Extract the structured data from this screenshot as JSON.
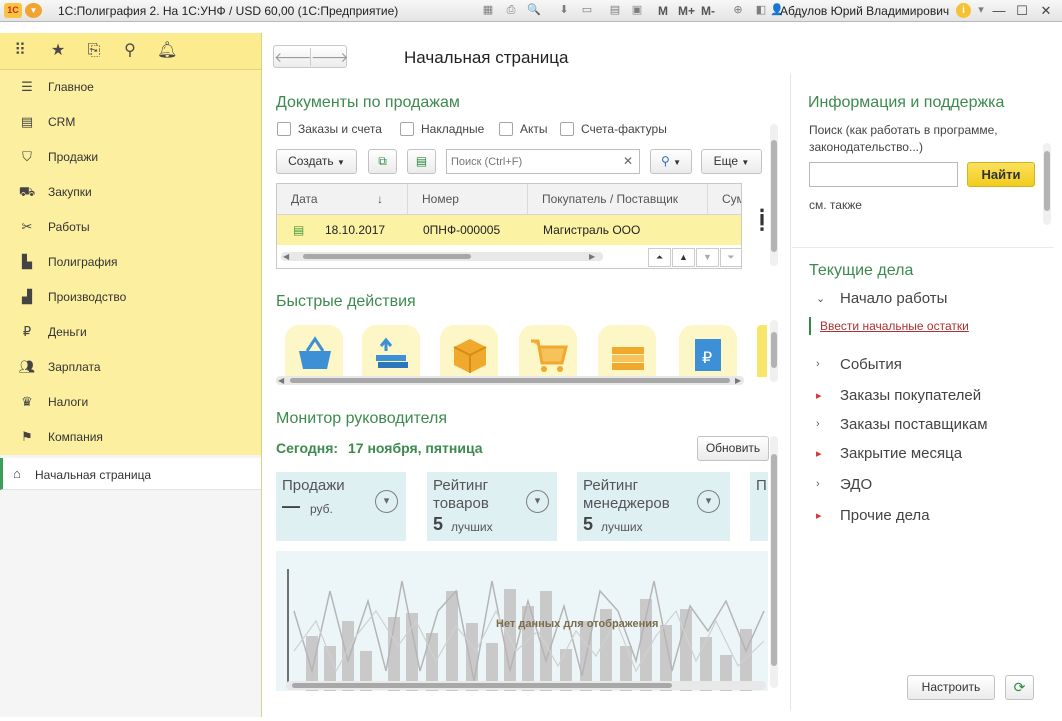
{
  "window": {
    "title": "1С:Полиграфия 2. На 1С:УНФ / USD 60,00 (1С:Предприятие)",
    "logo": "1С",
    "toolbar_text": [
      "M",
      "M+",
      "M-"
    ],
    "user": "Абдулов Юрий Владимирович"
  },
  "sidebar": {
    "top_icons": [
      "apps-grid-icon",
      "star-icon",
      "history-icon",
      "search-icon",
      "bell-icon"
    ],
    "sections": [
      {
        "label": "Главное",
        "icon": "list-icon"
      },
      {
        "label": "CRM",
        "icon": "crm-card-icon"
      },
      {
        "label": "Продажи",
        "icon": "basket-icon"
      },
      {
        "label": "Закупки",
        "icon": "cart-icon"
      },
      {
        "label": "Работы",
        "icon": "tools-icon"
      },
      {
        "label": "Полиграфия",
        "icon": "printing-icon"
      },
      {
        "label": "Производство",
        "icon": "factory-icon"
      },
      {
        "label": "Деньги",
        "icon": "ruble-icon"
      },
      {
        "label": "Зарплата",
        "icon": "people-icon"
      },
      {
        "label": "Налоги",
        "icon": "eagle-icon"
      },
      {
        "label": "Компания",
        "icon": "flag-icon"
      }
    ],
    "open_page": "Начальная страница"
  },
  "page": {
    "title": "Начальная страница"
  },
  "sales_docs": {
    "heading": "Документы по продажам",
    "filters": [
      "Заказы и счета",
      "Накладные",
      "Акты",
      "Счета-фактуры"
    ],
    "create_label": "Создать",
    "search_placeholder": "Поиск (Ctrl+F)",
    "more_label": "Еще",
    "columns": [
      "Дата",
      "Номер",
      "Покупатель / Поставщик",
      "Сум"
    ],
    "rows": [
      {
        "date": "18.10.2017",
        "number": "0ПНФ-000005",
        "partner": "Магистраль ООО"
      }
    ]
  },
  "quick_actions": {
    "heading": "Быстрые действия",
    "tiles": [
      "basket-tile-icon",
      "money-upload-tile-icon",
      "box-tile-icon",
      "cart-tile-icon",
      "money-stack-tile-icon",
      "payment-doc-tile-icon"
    ]
  },
  "monitor": {
    "heading": "Монитор руководителя",
    "today_label": "Сегодня:",
    "today_value": "17 ноября, пятница",
    "refresh_label": "Обновить",
    "kpis": [
      {
        "title": "Продажи",
        "big": "—",
        "small": "руб."
      },
      {
        "title_line1": "Рейтинг",
        "title_line2": "товаров",
        "big": "5",
        "small": "лучших"
      },
      {
        "title_line1": "Рейтинг",
        "title_line2": "менеджеров",
        "big": "5",
        "small": "лучших"
      },
      {
        "title": "П"
      }
    ],
    "no_data": "Нет данных для отображения"
  },
  "support": {
    "heading": "Информация и поддержка",
    "search_text": "Поиск (как работать в программе, законодательство...)",
    "find_label": "Найти",
    "see_also": "см. также"
  },
  "tasks": {
    "heading": "Текущие дела",
    "items": [
      {
        "label": "Начало работы",
        "expanded": true,
        "accent": false
      },
      {
        "label": "События",
        "expanded": false,
        "accent": false
      },
      {
        "label": "Заказы покупателей",
        "expanded": false,
        "accent": true
      },
      {
        "label": "Заказы поставщикам",
        "expanded": false,
        "accent": false
      },
      {
        "label": "Закрытие месяца",
        "expanded": false,
        "accent": true
      },
      {
        "label": "ЭДО",
        "expanded": false,
        "accent": false
      },
      {
        "label": "Прочие дела",
        "expanded": false,
        "accent": true
      }
    ],
    "intro_link": "Ввести начальные остатки",
    "configure_label": "Настроить"
  },
  "colors": {
    "accent_green": "#3c8a4e",
    "sidebar_yellow": "#fcf0a0",
    "row_highlight": "#fbf2a4",
    "find_button": "#f2cc1d",
    "kpi_bg": "#dff0f3"
  }
}
